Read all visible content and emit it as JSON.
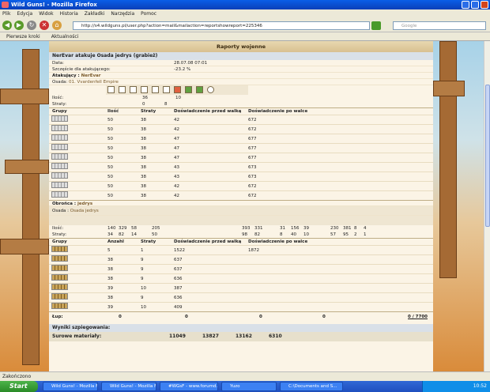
{
  "window": {
    "title": "Wild Guns! - Mozilla Firefox"
  },
  "menu": [
    "Plik",
    "Edycja",
    "Widok",
    "Historia",
    "Zakładki",
    "Narzędzia",
    "Pomoc"
  ],
  "nav": {
    "url": "http://s4.wildguns.pl/user.php?action=mail&mailaction=reportshowreport=225346",
    "search_placeholder": "Google"
  },
  "bookmarks": [
    "Pierwsze kroki",
    "Aktualności"
  ],
  "report": {
    "banner": "Raporty wojenne",
    "title": "NerEvar atakuje Osada jedrys (grabież)",
    "date_label": "Data:",
    "date_value": "28.07.08 07:01",
    "luck_label": "Szczęście dla atakującego:",
    "luck_value": "-23.2 %",
    "attacker_label": "Atakujący :",
    "attacker_name": "NerEvar",
    "settlement_label": "Osada:",
    "settlement_value": "01. Vvardenfell Empire",
    "att_qty_label": "Ilość:",
    "att_qty": [
      "36",
      "10"
    ],
    "att_loss_label": "Straty:",
    "att_loss": [
      "0",
      "8"
    ],
    "headers": {
      "groups": "Grupy",
      "qty": "Ilość",
      "losses": "Straty",
      "exp_before": "Doświadczenie przed walką",
      "exp_after": "Doświadczenie po walce"
    },
    "att_rows": [
      [
        "50",
        "38",
        "42",
        "672"
      ],
      [
        "50",
        "38",
        "42",
        "672"
      ],
      [
        "50",
        "38",
        "47",
        "677"
      ],
      [
        "50",
        "38",
        "47",
        "677"
      ],
      [
        "50",
        "38",
        "47",
        "677"
      ],
      [
        "50",
        "38",
        "43",
        "673"
      ],
      [
        "50",
        "38",
        "43",
        "673"
      ],
      [
        "50",
        "38",
        "42",
        "672"
      ],
      [
        "50",
        "38",
        "42",
        "672"
      ]
    ],
    "defender_label": "Obrońca :",
    "defender_name": "jedrys",
    "def_settlement_label": "Osada :",
    "def_settlement_value": "Osada jedrys",
    "def_qty_label": "Ilość:",
    "def_qty": [
      "140",
      "329",
      "58",
      "205",
      "393",
      "331",
      "31",
      "156",
      "39",
      "230",
      "381",
      "8",
      "4"
    ],
    "def_loss_label": "Straty:",
    "def_loss": [
      "34",
      "82",
      "14",
      "50",
      "98",
      "82",
      "8",
      "40",
      "10",
      "57",
      "95",
      "2",
      "1"
    ],
    "def_headers": {
      "groups": "Grupy",
      "qty": "Anzahl",
      "losses": "Straty",
      "exp_before": "Doświadczenie przed walką",
      "exp_after": "Doświadczenie po walce"
    },
    "def_rows": [
      [
        "5",
        "1",
        "1522",
        "1872"
      ],
      [
        "38",
        "9",
        "637",
        ""
      ],
      [
        "38",
        "9",
        "637",
        ""
      ],
      [
        "38",
        "9",
        "636",
        ""
      ],
      [
        "39",
        "10",
        "387",
        ""
      ],
      [
        "38",
        "9",
        "636",
        ""
      ],
      [
        "39",
        "10",
        "409",
        ""
      ]
    ],
    "loot_label": "Łup:",
    "loot_values": [
      "0",
      "0",
      "0",
      "0"
    ],
    "loot_total": "0 / 7700",
    "spy_label": "Wyniki szpiegowania:",
    "resources_label": "Surowe materiały:",
    "resources": [
      "11049",
      "13827",
      "13162",
      "6310"
    ]
  },
  "status": "Zakończono",
  "taskbar": {
    "start": "Start",
    "tasks": [
      "Wild Guns! - Mozilla Fi...",
      "Wild Guns! - Mozilla Fi...",
      "#WGsF - www.forumd...",
      "Yuzo",
      "C:\\Documents and S..."
    ],
    "clock": "10:52"
  }
}
